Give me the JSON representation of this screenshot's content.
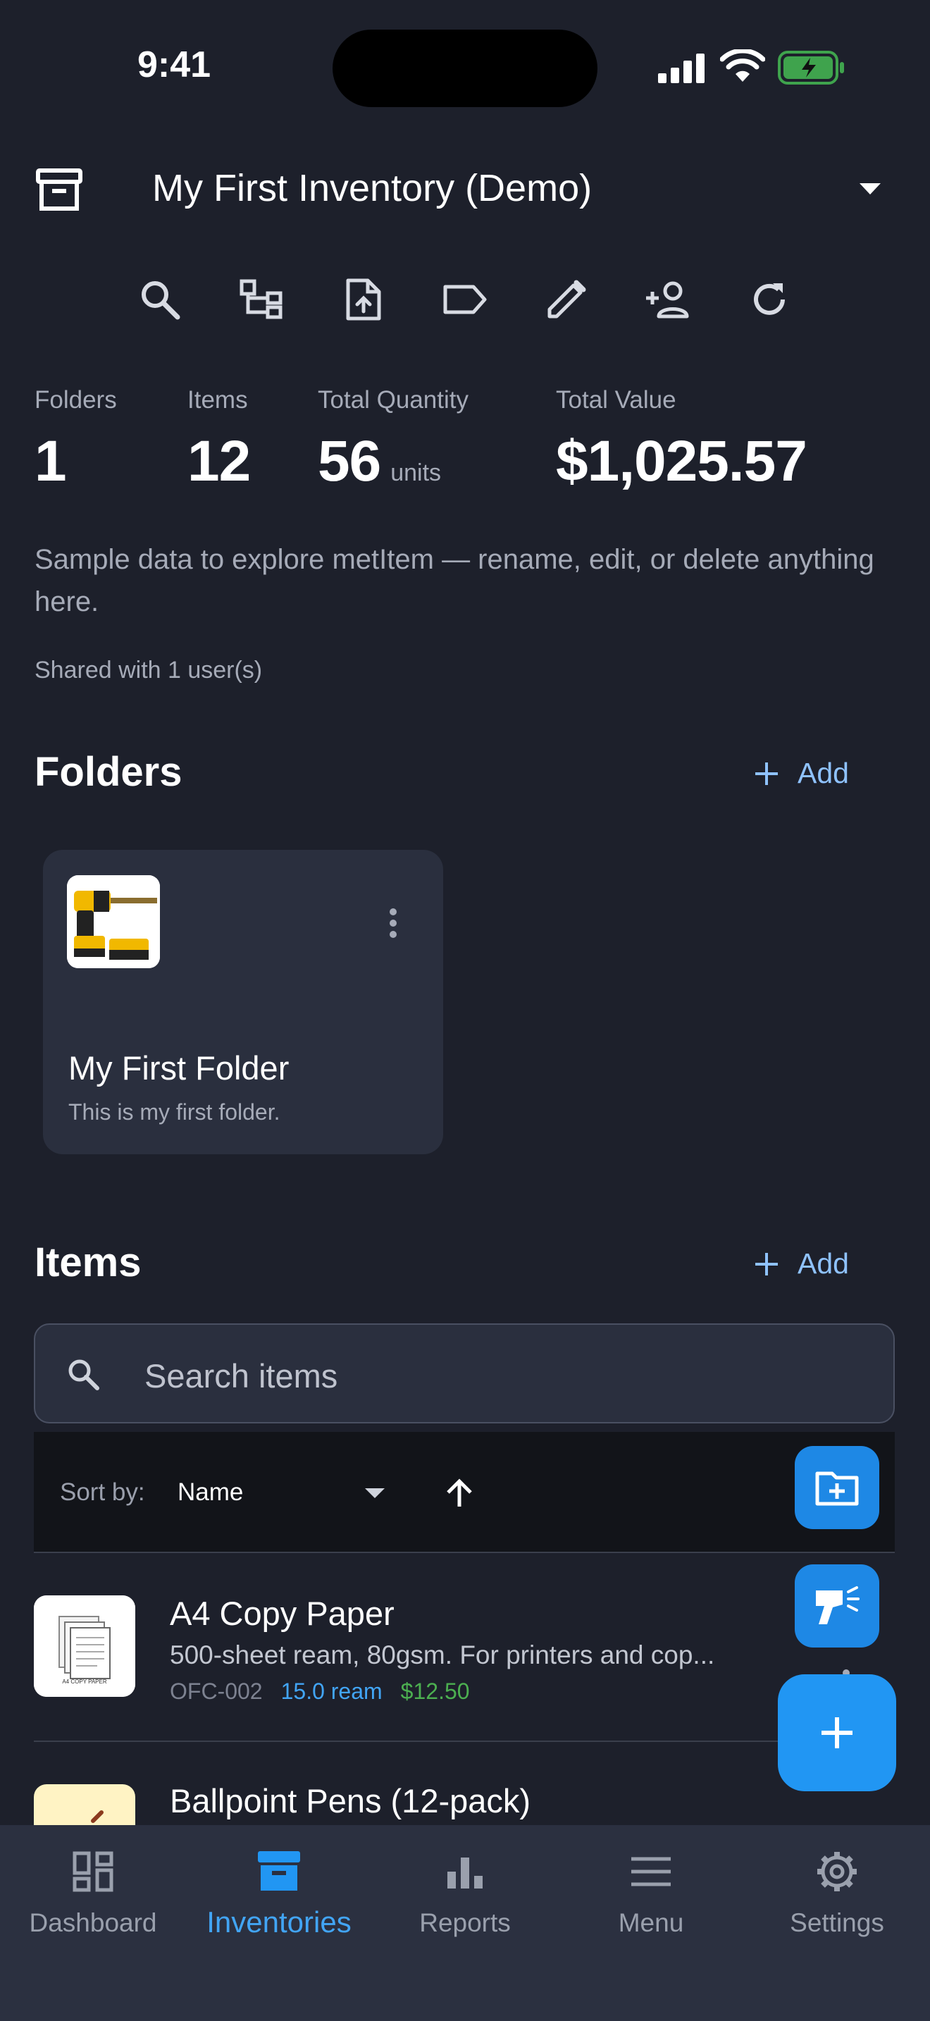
{
  "status_bar": {
    "time": "9:41"
  },
  "header": {
    "title": "My First Inventory (Demo)"
  },
  "stats": {
    "folders": {
      "label": "Folders",
      "value": "1"
    },
    "items": {
      "label": "Items",
      "value": "12"
    },
    "total_quantity": {
      "label": "Total Quantity",
      "value": "56",
      "unit": "units"
    },
    "total_value": {
      "label": "Total Value",
      "value": "$1,025.57"
    }
  },
  "description": "Sample data to explore metItem — rename, edit, or delete anything here.",
  "shared": "Shared with 1 user(s)",
  "folders_section": {
    "title": "Folders",
    "add_label": "Add",
    "folders": [
      {
        "name": "My First Folder",
        "description": "This is my first folder."
      }
    ]
  },
  "items_section": {
    "title": "Items",
    "add_label": "Add",
    "search_placeholder": "Search items",
    "sort_label": "Sort by:",
    "sort_value": "Name",
    "items": [
      {
        "name": "A4 Copy Paper",
        "description": "500-sheet ream, 80gsm. For printers and cop...",
        "sku": "OFC-002",
        "quantity": "15.0 ream",
        "price": "$12.50",
        "thumb_caption": "A4 COPY PAPER"
      },
      {
        "name": "Ballpoint Pens (12-pack)"
      }
    ]
  },
  "bottom_nav": [
    {
      "label": "Dashboard",
      "icon": "dashboard-icon"
    },
    {
      "label": "Inventories",
      "icon": "archive-icon",
      "active": true
    },
    {
      "label": "Reports",
      "icon": "bar-chart-icon"
    },
    {
      "label": "Menu",
      "icon": "menu-icon"
    },
    {
      "label": "Settings",
      "icon": "gear-icon"
    }
  ],
  "colors": {
    "accent": "#2196f3",
    "quantity": "#42a5f5",
    "price": "#4caf50",
    "background": "#1d202b",
    "card": "#2a2f3e"
  }
}
